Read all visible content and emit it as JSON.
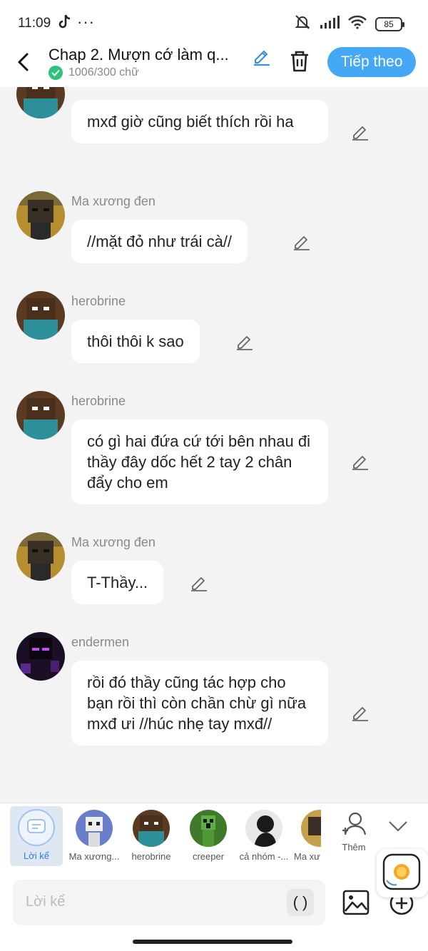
{
  "status_bar": {
    "time": "11:09",
    "battery": "85"
  },
  "header": {
    "title": "Chap 2. Mượn cớ làm q...",
    "word_count": "1006/300 chữ",
    "next_label": "Tiếp theo"
  },
  "messages": [
    {
      "speaker": "",
      "text": "mxđ giờ cũng biết thích rồi ha",
      "avatar": "herobrine"
    },
    {
      "speaker": "Ma xương đen",
      "text": "//mặt đỏ như trái cà//",
      "avatar": "wither-skeleton"
    },
    {
      "speaker": "herobrine",
      "text": "thôi thôi k sao",
      "avatar": "herobrine"
    },
    {
      "speaker": "herobrine",
      "text": "có gì hai đứa cứ tới bên nhau đi thầy đây dốc hết 2 tay 2 chân đẩy cho em",
      "avatar": "herobrine"
    },
    {
      "speaker": "Ma xương đen",
      "text": "T-Thầy...",
      "avatar": "wither-skeleton"
    },
    {
      "speaker": "endermen",
      "text": "rồi đó thầy cũng tác hợp cho bạn rồi thì còn chần chừ gì nữa mxđ ưi //húc nhẹ tay mxđ//",
      "avatar": "enderman"
    }
  ],
  "characters": [
    {
      "label": "Lời kể",
      "selected": true
    },
    {
      "label": "Ma xương..."
    },
    {
      "label": "herobrine"
    },
    {
      "label": "creeper"
    },
    {
      "label": "cả nhóm -..."
    },
    {
      "label": "Ma xư"
    }
  ],
  "more_label": "Thêm",
  "input": {
    "placeholder": "Lời kể",
    "paren_label": "( )"
  },
  "colors": {
    "accent": "#45a8f4",
    "check": "#2fc279",
    "background": "#f3f3f3"
  }
}
